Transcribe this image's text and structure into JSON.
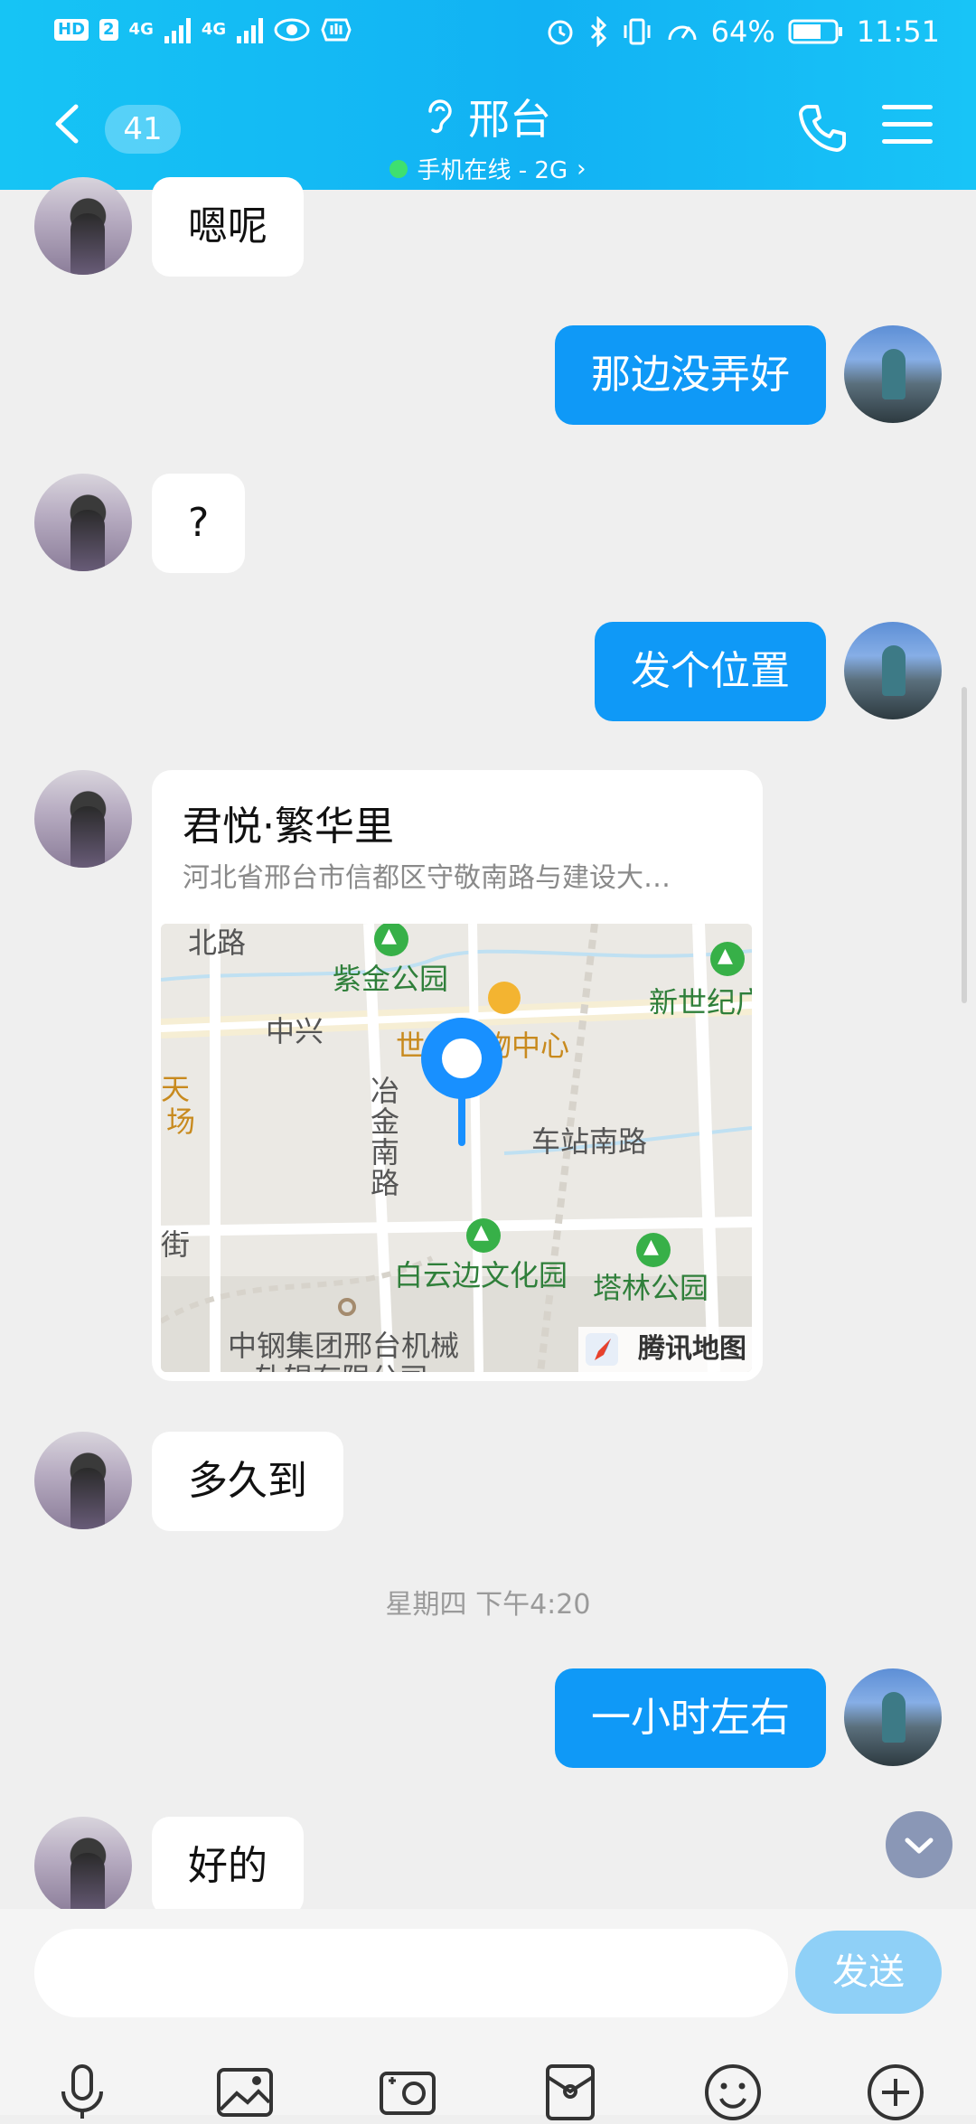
{
  "status_bar": {
    "left_badge": "HD",
    "left_sub": "2",
    "net1": "4G",
    "net2": "4G",
    "battery": "64%",
    "time": "11:51"
  },
  "header": {
    "unread_count": "41",
    "title": "邢台",
    "subtitle": "手机在线 - 2G",
    "subtitle_arrow": "›"
  },
  "messages": [
    {
      "from": "other",
      "text": "嗯呢"
    },
    {
      "from": "me",
      "text": "那边没弄好"
    },
    {
      "from": "other",
      "text": "?"
    },
    {
      "from": "me",
      "text": "发个位置"
    },
    {
      "from": "other",
      "text": "多久到"
    },
    {
      "from": "me",
      "text": "一小时左右"
    },
    {
      "from": "other",
      "text": "好的"
    }
  ],
  "location": {
    "name": "君悦·繁华里",
    "address": "河北省邢台市信都区守敬南路与建设大…",
    "map_labels": {
      "road_north": "北路",
      "park_zijin": "紫金公园",
      "zhongxing": "中兴",
      "shopping": "世纪购物中心",
      "xinshiji": "新世纪广",
      "tian": "天",
      "guangchang": "场",
      "yejin": "冶金南路",
      "station_road": "车站南路",
      "street": "街",
      "baiyunbian": "白云边文化园",
      "talin": "塔林公园",
      "zhonggang": "中钢集团邢台机械",
      "zhonggang2": "轧辊有限公司"
    },
    "map_brand": "腾讯地图"
  },
  "time_separator": "星期四 下午4:20",
  "input": {
    "placeholder": "",
    "send_label": "发送"
  },
  "toolbar_icons": [
    "microphone-icon",
    "image-icon",
    "camera-icon",
    "red-packet-icon",
    "emoji-icon",
    "plus-icon"
  ],
  "colors": {
    "header": "#14b8f4",
    "my_bubble": "#0f99f7",
    "send_disabled": "#8fd0f7"
  }
}
